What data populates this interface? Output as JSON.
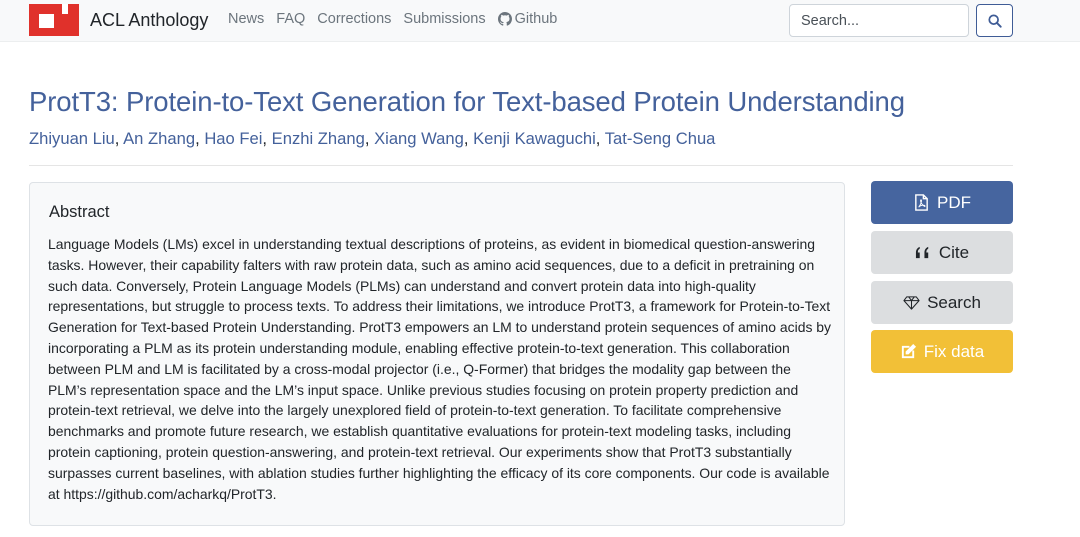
{
  "navbar": {
    "brand": "ACL Anthology",
    "links": [
      "News",
      "FAQ",
      "Corrections",
      "Submissions",
      "Github"
    ],
    "search_placeholder": "Search...",
    "search_button_icon": "search-icon"
  },
  "paper": {
    "title": "ProtT3: Protein-to-Text Generation for Text-based Protein Understanding",
    "authors": [
      "Zhiyuan Liu",
      "An Zhang",
      "Hao Fei",
      "Enzhi Zhang",
      "Xiang Wang",
      "Kenji Kawaguchi",
      "Tat-Seng Chua"
    ],
    "abstract_heading": "Abstract",
    "abstract": "Language Models (LMs) excel in understanding textual descriptions of proteins, as evident in biomedical question-answering tasks. However, their capability falters with raw protein data, such as amino acid sequences, due to a deficit in pretraining on such data. Conversely, Protein Language Models (PLMs) can understand and convert protein data into high-quality representations, but struggle to process texts. To address their limitations, we introduce ProtT3, a framework for Protein-to-Text Generation for Text-based Protein Understanding. ProtT3 empowers an LM to understand protein sequences of amino acids by incorporating a PLM as its protein understanding module, enabling effective protein-to-text generation. This collaboration between PLM and LM is facilitated by a cross-modal projector (i.e., Q-Former) that bridges the modality gap between the PLM’s representation space and the LM’s input space. Unlike previous studies focusing on protein property prediction and protein-text retrieval, we delve into the largely unexplored field of protein-to-text generation. To facilitate comprehensive benchmarks and promote future research, we establish quantitative evaluations for protein-text modeling tasks, including protein captioning, protein question-answering, and protein-text retrieval. Our experiments show that ProtT3 substantially surpasses current baselines, with ablation studies further highlighting the efficacy of its core components. Our code is available at https://github.com/acharkq/ProtT3."
  },
  "actions": {
    "pdf": "PDF",
    "cite": "Cite",
    "search": "Search",
    "fix": "Fix data"
  },
  "colors": {
    "link": "#44619b",
    "pdf_button": "#46659f",
    "fix_button": "#f2c037",
    "logo_red": "#e0312b"
  }
}
